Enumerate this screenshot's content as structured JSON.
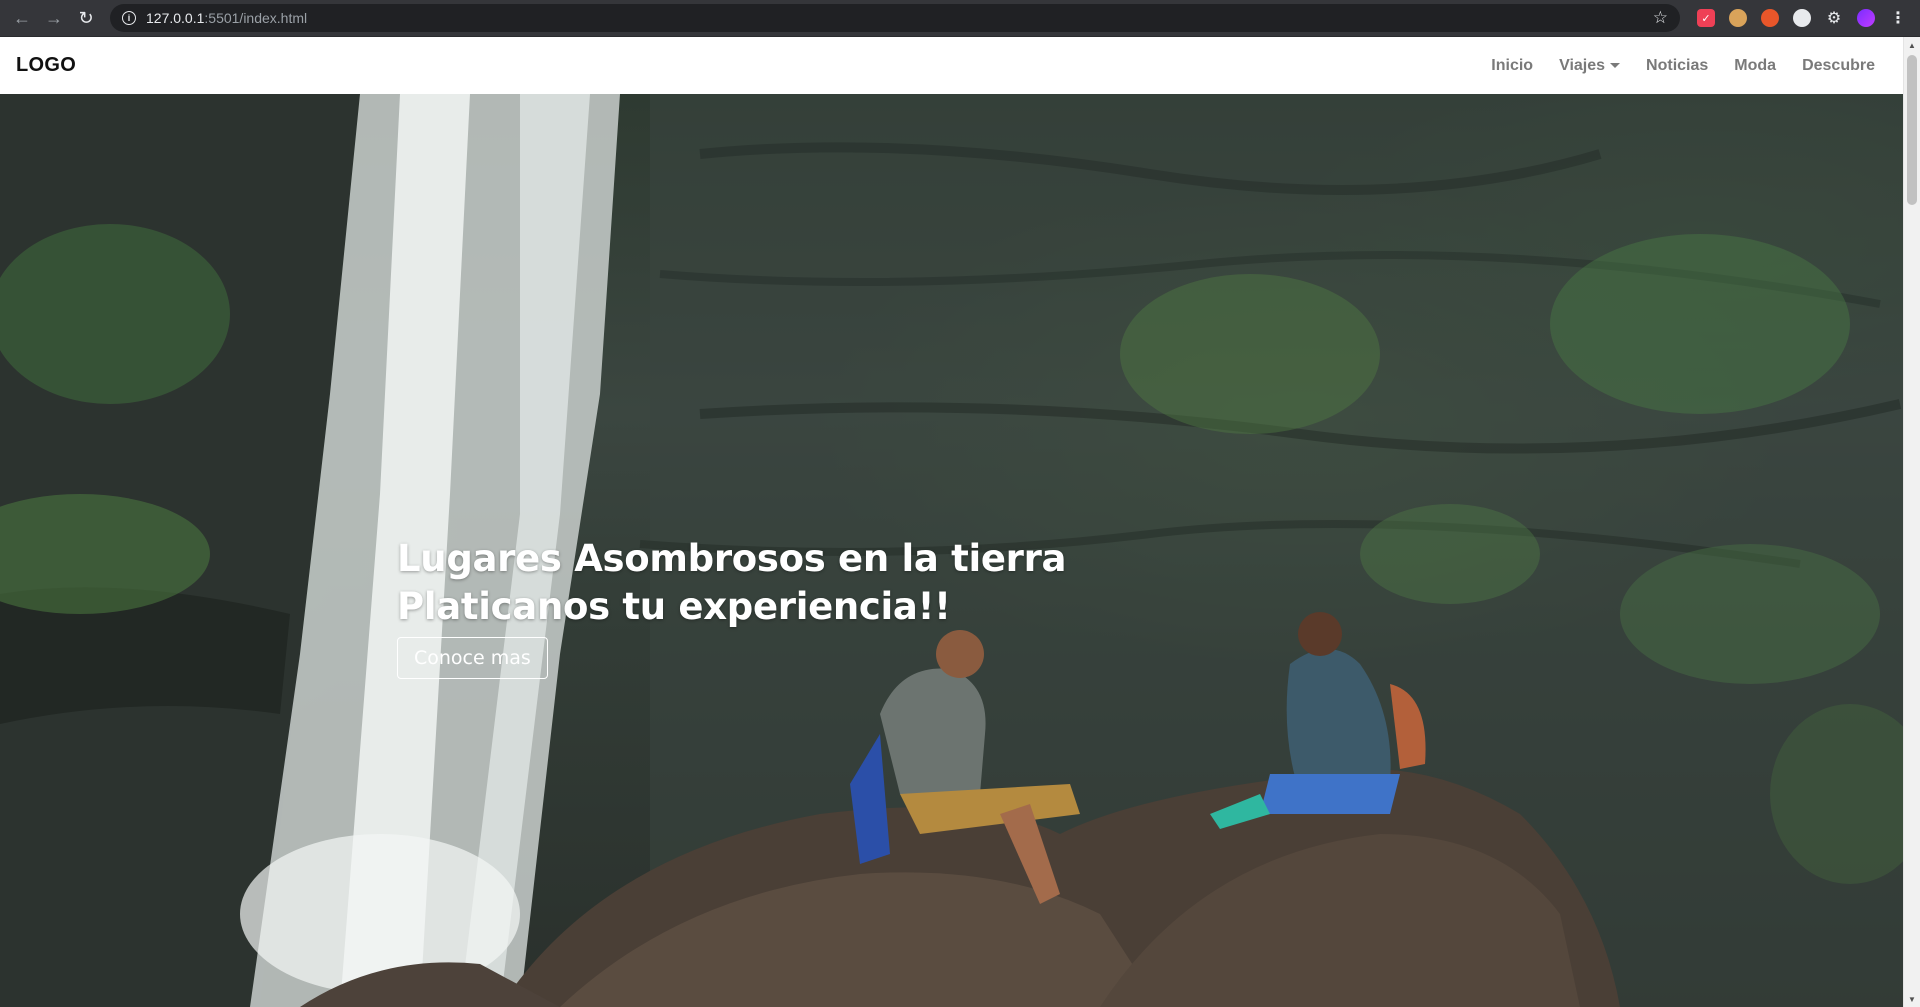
{
  "browser": {
    "url_host": "127.0.0.1",
    "url_rest": ":5501/index.html",
    "icons": [
      "back-icon",
      "forward-icon",
      "reload-icon",
      "info-icon",
      "star-icon",
      "pocket-icon",
      "cookie-icon",
      "fox-icon",
      "circle-extension-icon",
      "puzzle-icon",
      "profile-icon",
      "menu-icon"
    ]
  },
  "navbar": {
    "brand": "LOGO",
    "links": [
      {
        "label": "Inicio"
      },
      {
        "label": "Viajes",
        "dropdown": true
      },
      {
        "label": "Noticias"
      },
      {
        "label": "Moda"
      },
      {
        "label": "Descubre"
      }
    ],
    "background": "#ffffff",
    "link_color": "#7a7a7a"
  },
  "hero": {
    "title_line1": "Lugares Asombrosos en la tierra",
    "title_line2": "Platicanos tu experiencia!!",
    "button_label": "Conoce mas",
    "text_color": "#ffffff"
  }
}
